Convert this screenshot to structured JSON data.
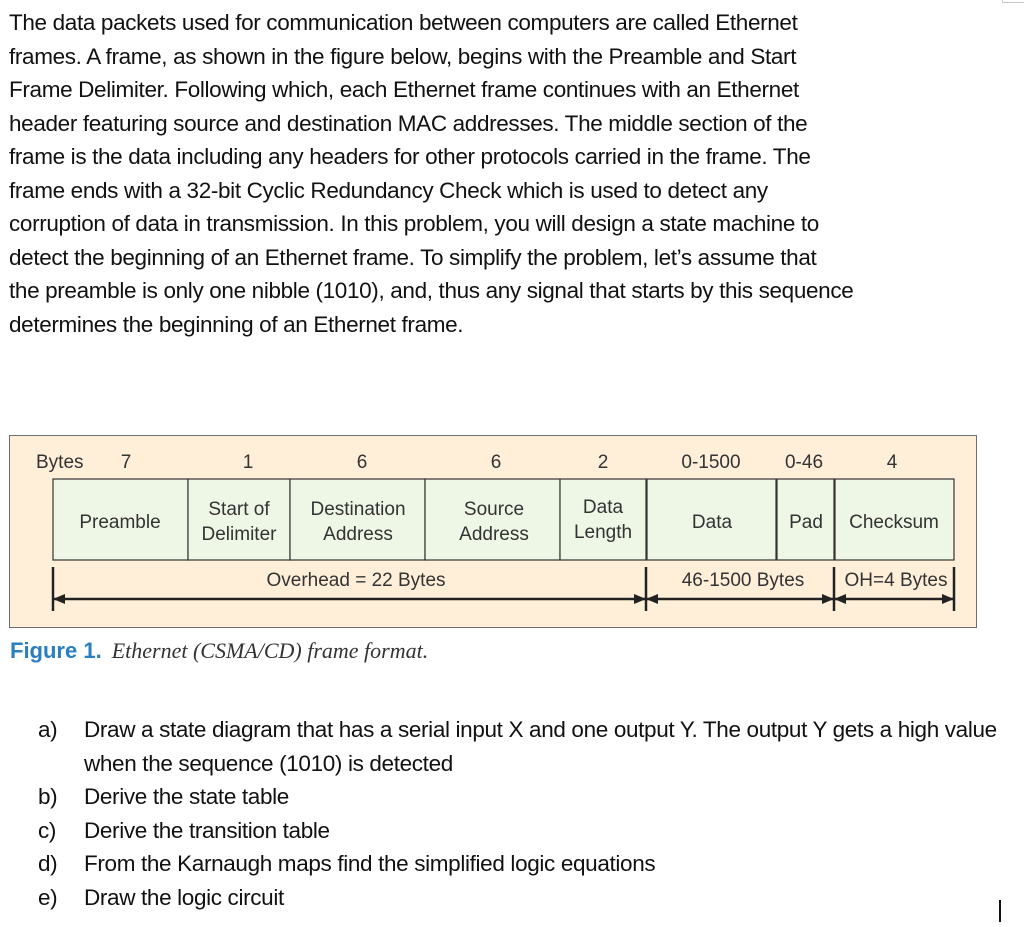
{
  "intro": {
    "lines": [
      "The data packets used for communication between computers are called Ethernet",
      "frames. A frame, as shown in the figure below, begins with the Preamble and Start",
      "Frame Delimiter. Following which, each Ethernet frame continues with an Ethernet",
      "header featuring source and destination MAC addresses. The middle section of the",
      "frame is the data including any headers for other protocols carried in the frame. The",
      "frame ends with a 32-bit Cyclic Redundancy Check which is used to detect any",
      "corruption of data in transmission. In this problem, you will design a state machine to",
      "detect the beginning of an Ethernet frame. To simplify the problem, let’s assume that",
      "the preamble is only one nibble (1010), and, thus any signal that starts by this sequence",
      "determines the beginning of an Ethernet frame."
    ]
  },
  "figure": {
    "bytes_label": "Bytes",
    "fields": [
      {
        "bytes": "7",
        "name_lines": [
          "Preamble"
        ]
      },
      {
        "bytes": "1",
        "name_lines": [
          "Start of",
          "Delimiter"
        ]
      },
      {
        "bytes": "6",
        "name_lines": [
          "Destination",
          "Address"
        ]
      },
      {
        "bytes": "6",
        "name_lines": [
          "Source",
          "Address"
        ]
      },
      {
        "bytes": "2",
        "name_lines": [
          "Data",
          "Length"
        ]
      },
      {
        "bytes": "0-1500",
        "name_lines": [
          "Data"
        ]
      },
      {
        "bytes": "0-46",
        "name_lines": [
          "Pad"
        ]
      },
      {
        "bytes": "4",
        "name_lines": [
          "Checksum"
        ]
      }
    ],
    "spans": [
      {
        "label": "Overhead = 22 Bytes"
      },
      {
        "label": "46-1500 Bytes"
      },
      {
        "label": "OH=4 Bytes"
      }
    ],
    "colors": {
      "background": "#FFEFD9",
      "cell": "#EEF6E6",
      "text": "#333333",
      "line": "#222222"
    },
    "caption": {
      "number": "Figure 1.",
      "text": "Ethernet (CSMA/CD) frame format."
    }
  },
  "questions": [
    {
      "letter": "a)",
      "text": "Draw a state diagram that has a serial input X and one output Y. The output Y gets a high value when the sequence (1010) is detected"
    },
    {
      "letter": "b)",
      "text": "Derive the state table"
    },
    {
      "letter": "c)",
      "text": "Derive the transition table"
    },
    {
      "letter": "d)",
      "text": "From the Karnaugh maps find the simplified logic equations"
    },
    {
      "letter": "e)",
      "text": "Draw the logic circuit"
    }
  ]
}
